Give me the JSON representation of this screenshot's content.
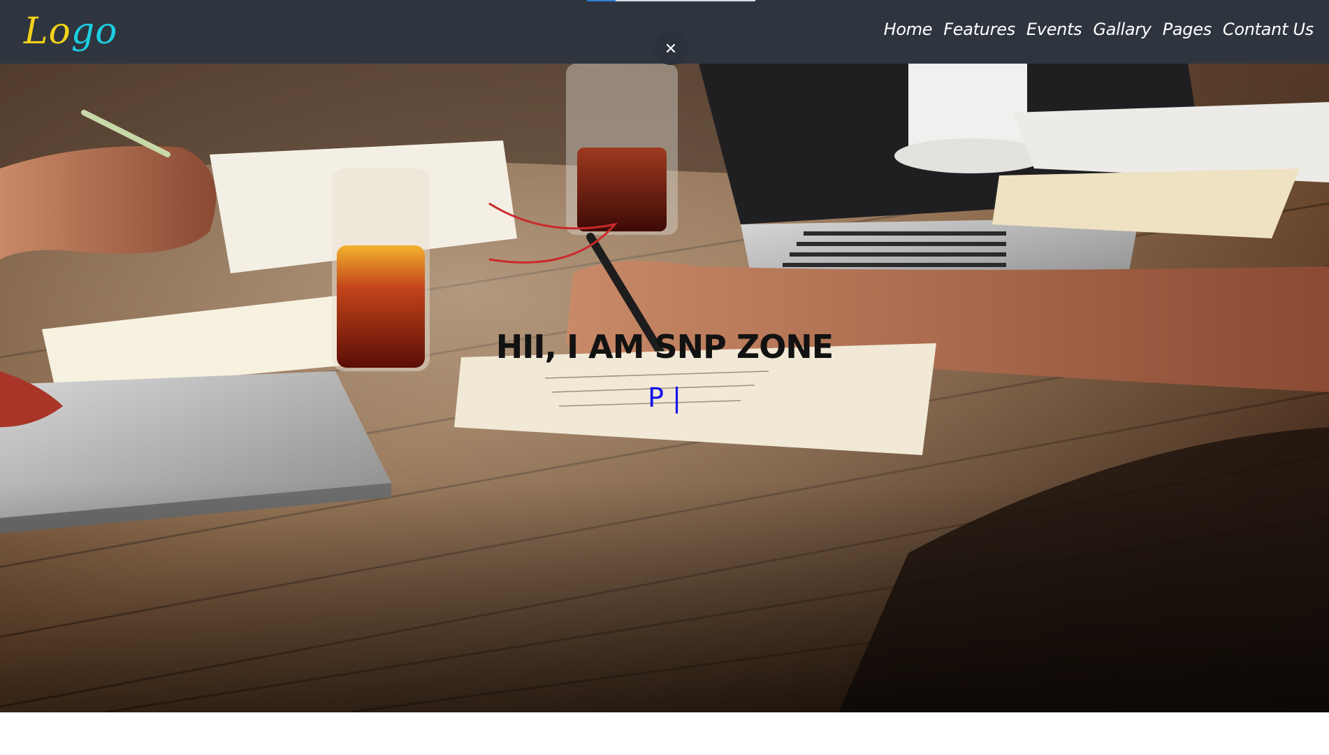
{
  "brand": {
    "logo_text_primary": "Lo",
    "logo_text_accent": "go",
    "logo_color": "#f3d21a",
    "logo_accent_color": "#1bd0e3"
  },
  "nav": {
    "items": [
      {
        "label": "Home"
      },
      {
        "label": "Features"
      },
      {
        "label": "Events"
      },
      {
        "label": "Pages"
      },
      {
        "label": "Gallary"
      },
      {
        "label": "Contant Us"
      }
    ],
    "bar_color": "#2f353f",
    "scroll_progress_fraction": 0.17
  },
  "overlay": {
    "close_icon": "close-icon",
    "close_glyph": "×"
  },
  "hero": {
    "title": "HII, I AM SNP ZONE",
    "typed_text": "P |",
    "typed_color": "#1313e8",
    "background_description_icon": "desk-photo"
  }
}
